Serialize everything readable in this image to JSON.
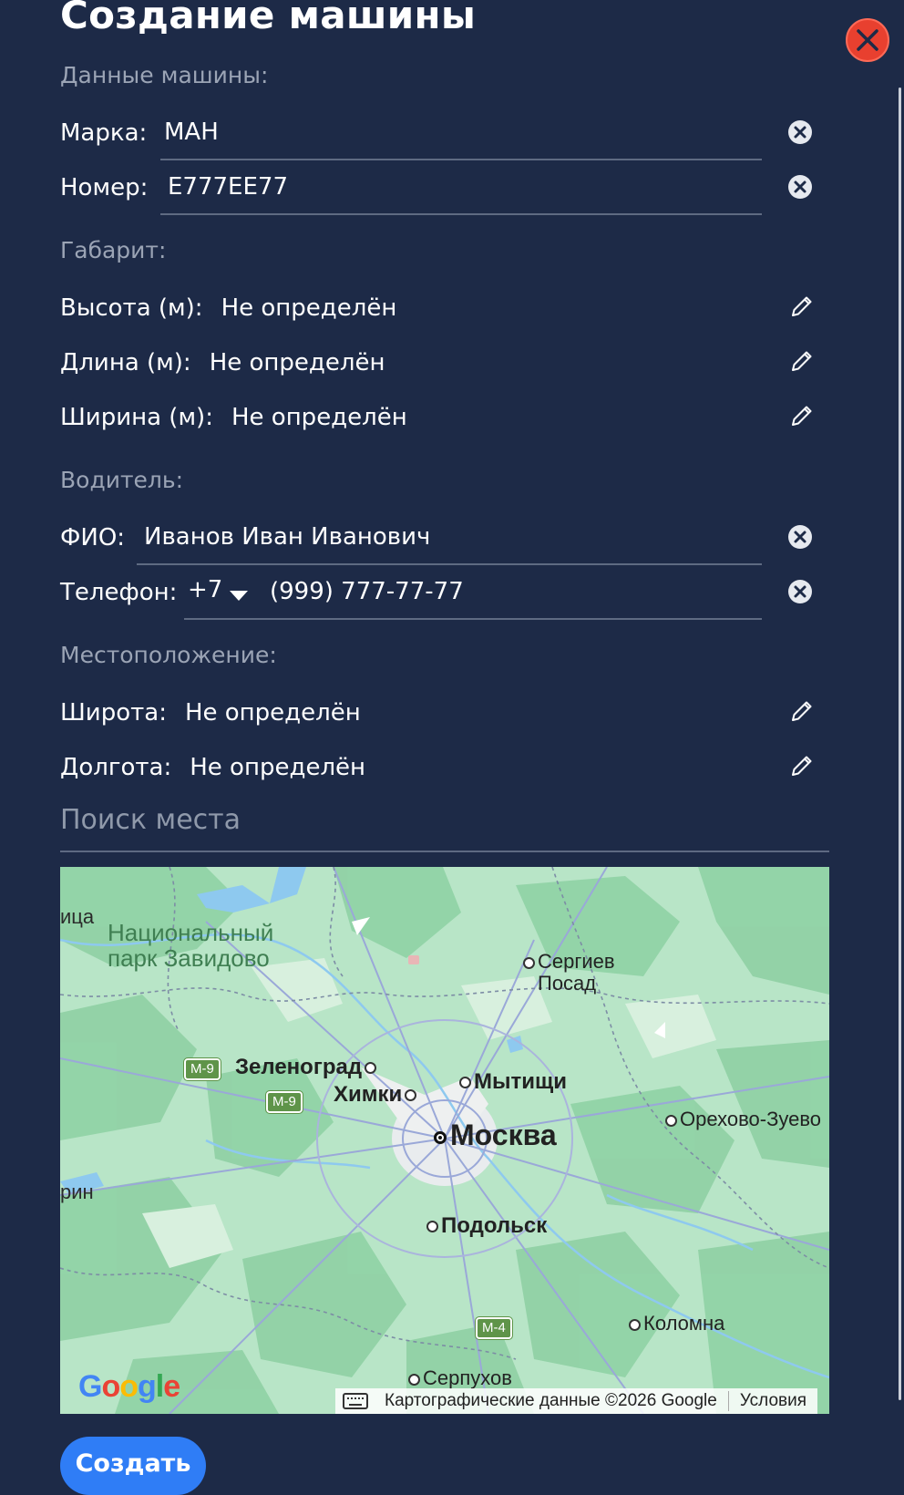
{
  "dialog": {
    "title": "Создание машины",
    "close_icon": "close-x-icon",
    "accent_color": "#e8402f"
  },
  "car": {
    "section_label": "Данные машины:",
    "brand_label": "Марка:",
    "brand_value": "МАН",
    "number_label": "Номер:",
    "number_value": "Е777ЕЕ77"
  },
  "dimensions": {
    "section_label": "Габарит:",
    "height_label": "Высота (м):",
    "height_value": "Не определён",
    "length_label": "Длина (м):",
    "length_value": "Не определён",
    "width_label": "Ширина (м):",
    "width_value": "Не определён"
  },
  "driver": {
    "section_label": "Водитель:",
    "name_label": "ФИО:",
    "name_value": "Иванов Иван Иванович",
    "phone_label": "Телефон:",
    "phone_code": "+7",
    "phone_value": "(999) 777-77-77"
  },
  "location": {
    "section_label": "Местоположение:",
    "lat_label": "Широта:",
    "lat_value": "Не определён",
    "lon_label": "Долгота:",
    "lon_value": "Не определён",
    "search_placeholder": "Поиск места"
  },
  "map": {
    "park_label_1": "Национальный",
    "park_label_2": "парк Завидово",
    "edge_label_top": "ица",
    "edge_label_left": "рин",
    "cities": {
      "sergiev_1": "Сергиев",
      "sergiev_2": "Посад",
      "zelenograd": "Зеленоград",
      "khimki": "Химки",
      "mytishchi": "Мытищи",
      "moscow": "Москва",
      "orekhovo": "Орехово-Зуево",
      "podolsk": "Подольск",
      "kolomna": "Коломна",
      "serpukhov": "Серпухов"
    },
    "shields": {
      "m9_a": "М-9",
      "m9_b": "М-9",
      "m4": "М-4"
    },
    "logo": "Google",
    "attribution": "Картографические данные ©2026 Google",
    "terms": "Условия"
  },
  "actions": {
    "create_label": "Создать",
    "create_color": "#2f7df6"
  }
}
